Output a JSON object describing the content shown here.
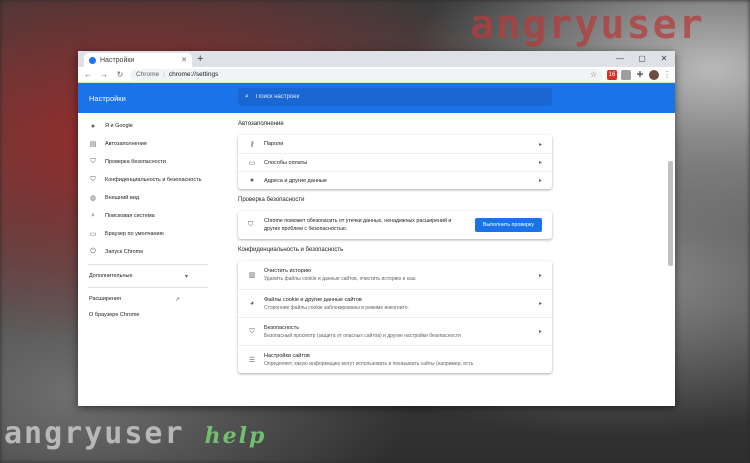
{
  "watermark": {
    "brand": "angryuser",
    "help": "help"
  },
  "window": {
    "tab_title": "Настройки",
    "new_tab": "+",
    "minimize": "—",
    "maximize": "▢",
    "close": "✕"
  },
  "toolbar": {
    "back": "←",
    "forward": "→",
    "reload": "↻",
    "site_label": "Chrome",
    "separator": "|",
    "url": "chrome://settings",
    "bookmark": "☆",
    "ext_badge": "16",
    "menu": "⋮"
  },
  "header": {
    "title": "Настройки",
    "search_placeholder": "Поиск настроек"
  },
  "sidebar": {
    "items": [
      {
        "icon": "person-icon",
        "glyph": "👤",
        "label": "Я и Google"
      },
      {
        "icon": "autofill-icon",
        "glyph": "📋",
        "label": "Автозаполнение"
      },
      {
        "icon": "shield-icon",
        "glyph": "🛡",
        "label": "Проверка безопасности"
      },
      {
        "icon": "privacy-shield-icon",
        "glyph": "🛡",
        "label": "Конфиденциальность и безопасность"
      },
      {
        "icon": "palette-icon",
        "glyph": "🎨",
        "label": "Внешний вид"
      },
      {
        "icon": "search-icon",
        "glyph": "🔍",
        "label": "Поисковая система"
      },
      {
        "icon": "browser-icon",
        "glyph": "▭",
        "label": "Браузер по умолчанию"
      },
      {
        "icon": "power-icon",
        "glyph": "⏻",
        "label": "Запуск Chrome"
      }
    ],
    "advanced": "Дополнительные",
    "advanced_chevron": "▾",
    "extensions": "Расширения",
    "extensions_icon": "↗",
    "about": "О браузере Chrome"
  },
  "main": {
    "autofill": {
      "title": "Автозаполнение",
      "rows": [
        {
          "icon": "key-icon",
          "glyph": "🔑",
          "label": "Пароли"
        },
        {
          "icon": "card-icon",
          "glyph": "💳",
          "label": "Способы оплаты"
        },
        {
          "icon": "location-icon",
          "glyph": "📍",
          "label": "Адреса и другие данные"
        }
      ]
    },
    "safety": {
      "title": "Проверка безопасности",
      "message": "Chrome поможет обезопасить от утечки данных, ненадежных расширений и других проблем с безопасностью.",
      "button": "Выполнить проверку"
    },
    "privacy": {
      "title": "Конфиденциальность и безопасность",
      "rows": [
        {
          "icon": "trash-icon",
          "glyph": "🗑",
          "label": "Очистить историю",
          "sub": "Удалить файлы cookie и данные сайтов, очистить историю и кэш"
        },
        {
          "icon": "cookie-icon",
          "glyph": "🍪",
          "label": "Файлы cookie и другие данные сайтов",
          "sub": "Сторонние файлы cookie заблокированы в режиме инкогнито."
        },
        {
          "icon": "security-icon",
          "glyph": "🛡",
          "label": "Безопасность",
          "sub": "Безопасный просмотр (защита от опасных сайтов) и другие настройки безопасности"
        },
        {
          "icon": "site-settings-icon",
          "glyph": "⚙",
          "label": "Настройки сайтов",
          "sub": "Определяет, какую информацию могут использовать и показывать сайты (например, есть"
        }
      ]
    },
    "arrow": "▸"
  }
}
